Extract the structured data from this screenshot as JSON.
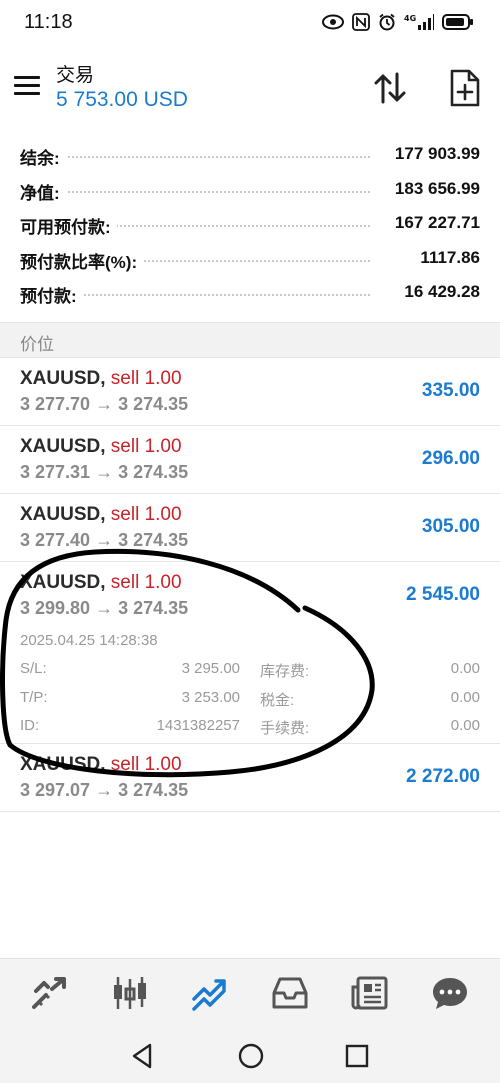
{
  "status_bar": {
    "time": "11:18",
    "icons": [
      "eye-icon",
      "nfc-icon",
      "alarm-icon",
      "signal-4g-icon",
      "battery-icon"
    ],
    "network_label": "4G"
  },
  "header": {
    "title": "交易",
    "balance": "5 753.00 USD",
    "balance_color": "#1b7bd0"
  },
  "summary": [
    {
      "label": "结余:",
      "value": "177 903.99"
    },
    {
      "label": "净值:",
      "value": "183 656.99"
    },
    {
      "label": "可用预付款:",
      "value": "167 227.71"
    },
    {
      "label": "预付款比率(%):",
      "value": "1117.86"
    },
    {
      "label": "预付款:",
      "value": "16 429.28"
    }
  ],
  "section_title": "价位",
  "positions": [
    {
      "symbol": "XAUUSD,",
      "side": "sell 1.00",
      "prices": "3 277.70 → 3 274.35",
      "profit": "335.00"
    },
    {
      "symbol": "XAUUSD,",
      "side": "sell 1.00",
      "prices": "3 277.31 → 3 274.35",
      "profit": "296.00"
    },
    {
      "symbol": "XAUUSD,",
      "side": "sell 1.00",
      "prices": "3 277.40 → 3 274.35",
      "profit": "305.00"
    },
    {
      "symbol": "XAUUSD,",
      "side": "sell 1.00",
      "prices": "3 299.80 → 3 274.35",
      "profit": "2 545.00",
      "details": {
        "time": "2025.04.25 14:28:38",
        "sl_label": "S/L:",
        "sl_value": "3 295.00",
        "tp_label": "T/P:",
        "tp_value": "3 253.00",
        "id_label": "ID:",
        "id_value": "1431382257",
        "swap_label": "库存费:",
        "swap_value": "0.00",
        "tax_label": "税金:",
        "tax_value": "0.00",
        "fee_label": "手续费:",
        "fee_value": "0.00"
      }
    },
    {
      "symbol": "XAUUSD,",
      "side": "sell 1.00",
      "prices": "3 297.07 → 3 274.35",
      "profit": "2 272.00"
    }
  ],
  "colors": {
    "accent": "#1b7bd0",
    "sell": "#c8242a"
  },
  "bottom_nav": [
    "quotes-icon",
    "chart-icon",
    "trade-icon",
    "history-icon",
    "news-icon",
    "messages-icon"
  ],
  "active_nav": "trade-icon"
}
